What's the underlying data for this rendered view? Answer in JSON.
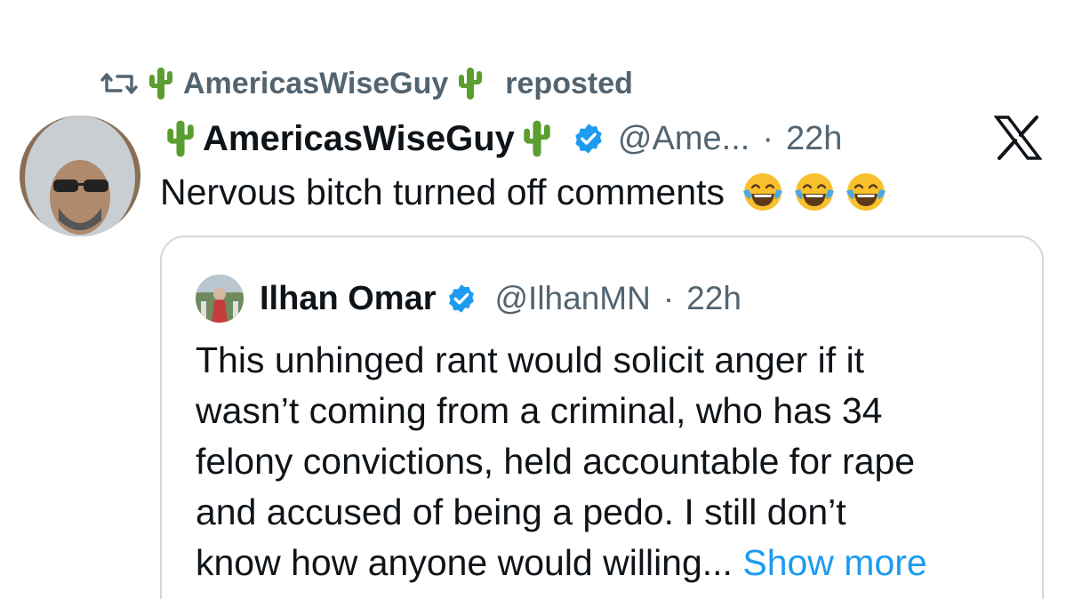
{
  "repost": {
    "user_name": "AmericasWiseGuy",
    "action": "reposted",
    "icon": "repost-icon",
    "emoji": "cactus"
  },
  "tweet": {
    "author_name": "AmericasWiseGuy",
    "author_emoji": "cactus",
    "verified_icon": "verified-badge-icon",
    "handle": "@Ame...",
    "separator": "·",
    "time": "22h",
    "text": "Nervous bitch turned off comments",
    "emojis": [
      "face-with-tears-of-joy",
      "face-with-tears-of-joy",
      "face-with-tears-of-joy"
    ]
  },
  "brand": {
    "logo": "x-logo"
  },
  "quote": {
    "author_name": "Ilhan Omar",
    "verified_icon": "verified-badge-icon",
    "handle": "@IlhanMN",
    "separator": "·",
    "time": "22h",
    "lines": [
      "This unhinged rant would solicit anger if it",
      "wasn’t coming from a criminal, who has 34",
      "felony convictions, held accountable for rape",
      "and accused of being a pedo. I still don’t",
      "know how anyone would willing..."
    ],
    "show_more": "Show more"
  },
  "colors": {
    "text": "#0f1419",
    "secondary": "#536471",
    "link": "#1d9bf0",
    "verified": "#1d9bf0",
    "border": "#cfd9de",
    "cactus": "#5a9e2f"
  }
}
